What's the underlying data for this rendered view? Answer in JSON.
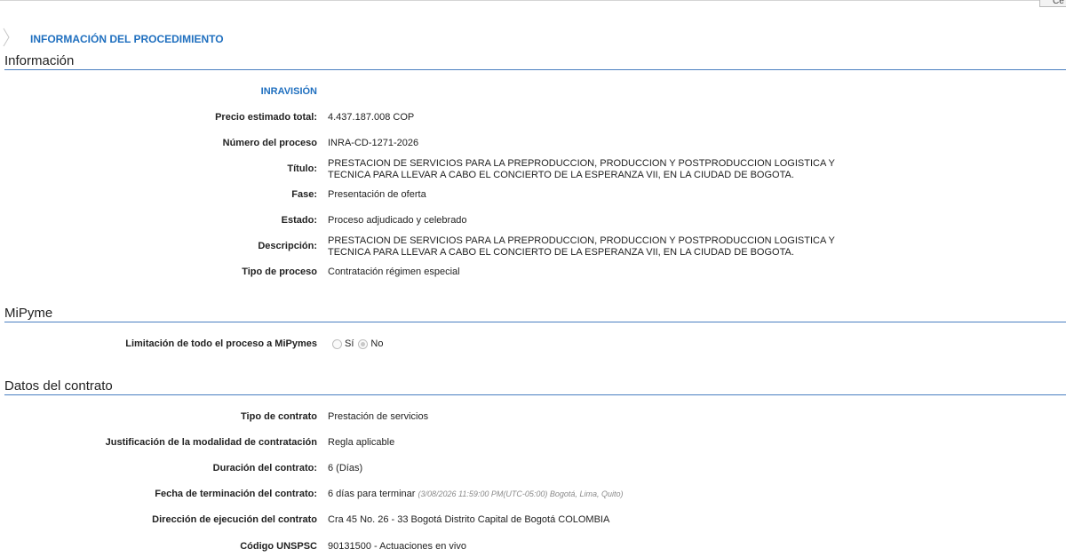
{
  "header": {
    "procedure_title": "INFORMACIÓN DEL PROCEDIMIENTO",
    "corner_button": "Ce"
  },
  "sections": {
    "informacion": "Información",
    "mipyme": "MiPyme",
    "datos_contrato": "Datos del contrato"
  },
  "informacion": {
    "entity": "INRAVISIÓN",
    "precio_label": "Precio estimado total:",
    "precio_value": "4.437.187.008 COP",
    "numero_label": "Número del proceso",
    "numero_value": "INRA-CD-1271-2026",
    "titulo_label": "Título:",
    "titulo_value": "PRESTACION DE SERVICIOS PARA LA PREPRODUCCION, PRODUCCION Y POSTPRODUCCION LOGISTICA Y TECNICA PARA LLEVAR A CABO EL CONCIERTO DE LA ESPERANZA VII, EN LA CIUDAD DE BOGOTA.",
    "fase_label": "Fase:",
    "fase_value": "Presentación de oferta",
    "estado_label": "Estado:",
    "estado_value": "Proceso adjudicado y celebrado",
    "descripcion_label": "Descripción:",
    "descripcion_value": "PRESTACION DE SERVICIOS PARA LA PREPRODUCCION, PRODUCCION Y POSTPRODUCCION LOGISTICA Y TECNICA PARA LLEVAR A CABO EL CONCIERTO DE LA ESPERANZA VII, EN LA CIUDAD DE BOGOTA.",
    "tipo_label": "Tipo de proceso",
    "tipo_value": "Contratación régimen especial"
  },
  "mipyme": {
    "limitacion_label": "Limitación de todo el proceso a MiPymes",
    "option_si": "Sí",
    "option_no": "No",
    "selected": "No"
  },
  "contrato": {
    "tipo_label": "Tipo de contrato",
    "tipo_value": "Prestación de servicios",
    "justificacion_label": "Justificación de la modalidad de contratación",
    "justificacion_value": "Regla aplicable",
    "duracion_label": "Duración del contrato:",
    "duracion_value": "6 (Días)",
    "fecha_label": "Fecha de terminación del contrato:",
    "fecha_value": "6 días para terminar",
    "fecha_note": "(3/08/2026 11:59:00 PM(UTC-05:00) Bogotá, Lima, Quito)",
    "direccion_label": "Dirección de ejecución del contrato",
    "direccion_value": "Cra 45 No. 26 - 33 Bogotá Distrito Capital de Bogotá COLOMBIA",
    "unspsc_label": "Código UNSPSC",
    "unspsc_value": "90131500 - Actuaciones en vivo"
  },
  "colors": {
    "accent": "#1f6fbf",
    "rule": "#4a7fc1",
    "text": "#222222",
    "note": "#8a8a8a"
  }
}
